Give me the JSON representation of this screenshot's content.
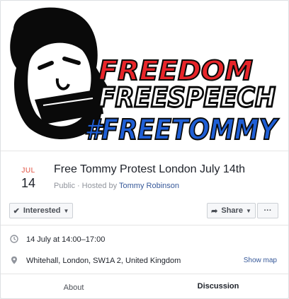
{
  "cover": {
    "line1": "FREEDOM",
    "line2": "FREESPEECH",
    "line3": "#FREETOMMY",
    "colors": {
      "red": "#e8252a",
      "blue": "#1f5fd6",
      "black": "#0a0a0a"
    }
  },
  "event": {
    "month": "JUL",
    "day": "14",
    "title": "Free Tommy Protest London July 14th",
    "privacy": "Public",
    "separator": "·",
    "hosted_by_prefix": "Hosted by",
    "host_name": "Tommy Robinson"
  },
  "actions": {
    "interested_label": "Interested",
    "interested_icon": "check-icon",
    "share_label": "Share",
    "share_icon": "share-arrow-icon",
    "more_label": "···"
  },
  "details": {
    "time_icon": "clock-icon",
    "time_text": "14 July at 14:00–17:00",
    "place_icon": "map-pin-icon",
    "place_text": "Whitehall, London, SW1A 2, United Kingdom",
    "show_map_label": "Show map"
  },
  "tabs": {
    "about": "About",
    "discussion": "Discussion",
    "active": "discussion"
  },
  "colors": {
    "link": "#365899",
    "month": "#e04c3b",
    "tab_active": "#4267b2"
  }
}
